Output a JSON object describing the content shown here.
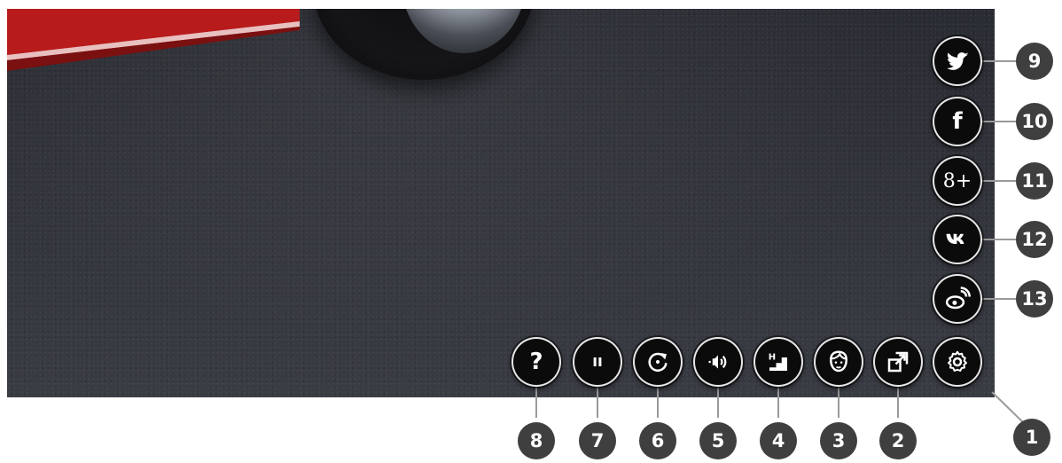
{
  "viewer": {
    "controls": [
      {
        "id": 1,
        "icon": "gear-icon"
      },
      {
        "id": 2,
        "icon": "fullscreen-icon"
      },
      {
        "id": 3,
        "icon": "face-icon"
      },
      {
        "id": 4,
        "icon": "quality-icon",
        "glyph": "H"
      },
      {
        "id": 5,
        "icon": "sound-icon"
      },
      {
        "id": 6,
        "icon": "rotate-icon"
      },
      {
        "id": 7,
        "icon": "pause-icon"
      },
      {
        "id": 8,
        "icon": "help-icon",
        "glyph": "?"
      }
    ],
    "social": [
      {
        "id": 9,
        "icon": "twitter-icon"
      },
      {
        "id": 10,
        "icon": "facebook-icon",
        "glyph": "f"
      },
      {
        "id": 11,
        "icon": "google-plus-icon",
        "glyph": "8+"
      },
      {
        "id": 12,
        "icon": "vk-icon"
      },
      {
        "id": 13,
        "icon": "weibo-icon"
      }
    ]
  },
  "callouts": {
    "c1": "1",
    "c2": "2",
    "c3": "3",
    "c4": "4",
    "c5": "5",
    "c6": "6",
    "c7": "7",
    "c8": "8",
    "c9": "9",
    "c10": "10",
    "c11": "11",
    "c12": "12",
    "c13": "13"
  }
}
